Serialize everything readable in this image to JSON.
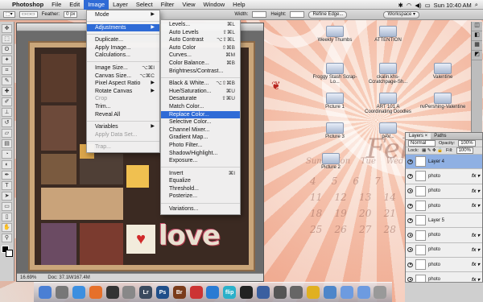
{
  "menubar": {
    "app_name": "Photoshop",
    "items": [
      "File",
      "Edit",
      "Image",
      "Layer",
      "Select",
      "Filter",
      "View",
      "Window",
      "Help"
    ],
    "active": "Image",
    "clock": "Sun 10:40 AM"
  },
  "options": {
    "feather_label": "Feather:",
    "feather_value": "0 px",
    "width_label": "Width:",
    "height_label": "Height:",
    "refine_edge": "Refine Edge...",
    "workspace": "Workspace ▾"
  },
  "document": {
    "title": "",
    "zoom": "16.69%",
    "doc_info": "Doc: 37.1M/167.4M"
  },
  "image_menu": [
    {
      "label": "Mode",
      "submenu": true
    },
    {
      "sep": true
    },
    {
      "label": "Adjustments",
      "submenu": true,
      "selected": true
    },
    {
      "sep": true
    },
    {
      "label": "Duplicate..."
    },
    {
      "label": "Apply Image..."
    },
    {
      "label": "Calculations..."
    },
    {
      "sep": true
    },
    {
      "label": "Image Size...",
      "shortcut": "⌥⌘I"
    },
    {
      "label": "Canvas Size...",
      "shortcut": "⌥⌘C"
    },
    {
      "label": "Pixel Aspect Ratio",
      "submenu": true
    },
    {
      "label": "Rotate Canvas",
      "submenu": true
    },
    {
      "label": "Crop",
      "disabled": true
    },
    {
      "label": "Trim..."
    },
    {
      "label": "Reveal All"
    },
    {
      "sep": true
    },
    {
      "label": "Variables",
      "submenu": true
    },
    {
      "label": "Apply Data Set...",
      "disabled": true
    },
    {
      "sep": true
    },
    {
      "label": "Trap...",
      "disabled": true
    }
  ],
  "adjustments_menu": [
    {
      "label": "Levels...",
      "shortcut": "⌘L"
    },
    {
      "label": "Auto Levels",
      "shortcut": "⇧⌘L"
    },
    {
      "label": "Auto Contrast",
      "shortcut": "⌥⇧⌘L"
    },
    {
      "label": "Auto Color",
      "shortcut": "⇧⌘B"
    },
    {
      "label": "Curves...",
      "shortcut": "⌘M"
    },
    {
      "label": "Color Balance...",
      "shortcut": "⌘B"
    },
    {
      "label": "Brightness/Contrast..."
    },
    {
      "sep": true
    },
    {
      "label": "Black & White...",
      "shortcut": "⌥⇧⌘B"
    },
    {
      "label": "Hue/Saturation...",
      "shortcut": "⌘U"
    },
    {
      "label": "Desaturate",
      "shortcut": "⇧⌘U"
    },
    {
      "label": "Match Color..."
    },
    {
      "label": "Replace Color...",
      "selected": true
    },
    {
      "label": "Selective Color..."
    },
    {
      "label": "Channel Mixer..."
    },
    {
      "label": "Gradient Map..."
    },
    {
      "label": "Photo Filter..."
    },
    {
      "label": "Shadow/Highlight..."
    },
    {
      "label": "Exposure..."
    },
    {
      "sep": true
    },
    {
      "label": "Invert",
      "shortcut": "⌘I"
    },
    {
      "label": "Equalize"
    },
    {
      "label": "Threshold..."
    },
    {
      "label": "Posterize..."
    },
    {
      "sep": true
    },
    {
      "label": "Variations..."
    }
  ],
  "desktop_icons": [
    "Weekly Thumbs",
    "ATTENTION",
    "Froggy Stash Scrap-Lo...",
    "ckalin.khs-Ccratchpage-Sh...",
    "Valentine",
    "Picture 1",
    "Picture 3",
    "ART 101 A Coordinating Doodles",
    "nvPershing-Valentine",
    "Picture 2",
    "pAV..."
  ],
  "layers_panel": {
    "tabs": [
      "Layers ×",
      "Paths"
    ],
    "blend_mode": "Normal",
    "opacity_label": "Opacity:",
    "opacity_value": "100%",
    "lock_label": "Lock:",
    "fill_label": "Fill:",
    "fill_value": "100%",
    "rows": [
      {
        "name": "Layer 4",
        "fx": false,
        "selected": true
      },
      {
        "name": "photo",
        "fx": true
      },
      {
        "name": "photo",
        "fx": true
      },
      {
        "name": "photo",
        "fx": true
      },
      {
        "name": "Layer 5",
        "fx": false
      },
      {
        "name": "photo",
        "fx": true
      },
      {
        "name": "photo",
        "fx": true
      },
      {
        "name": "photo",
        "fx": true
      },
      {
        "name": "photo",
        "fx": true
      }
    ]
  },
  "dock": [
    {
      "name": "finder-icon",
      "label": "",
      "color": "#4a7fd4"
    },
    {
      "name": "system-preferences-icon",
      "label": "",
      "color": "#777"
    },
    {
      "name": "safari-icon",
      "label": "",
      "color": "#3c8fe0"
    },
    {
      "name": "firefox-icon",
      "label": "",
      "color": "#e6702a"
    },
    {
      "name": "dashboard-icon",
      "label": "",
      "color": "#333"
    },
    {
      "name": "photos-icon",
      "label": "",
      "color": "#888"
    },
    {
      "name": "lightroom-icon",
      "label": "Lr",
      "color": "#3a4a5e"
    },
    {
      "name": "photoshop-icon",
      "label": "Ps",
      "color": "#1f4f8a"
    },
    {
      "name": "bridge-icon",
      "label": "Br",
      "color": "#7a3b1a"
    },
    {
      "name": "ical-icon",
      "label": "",
      "color": "#c33"
    },
    {
      "name": "itunes-icon",
      "label": "",
      "color": "#2a7bd3"
    },
    {
      "name": "flip-icon",
      "label": "flip",
      "color": "#2bb0c9"
    },
    {
      "name": "clapboard-icon",
      "label": "",
      "color": "#222"
    },
    {
      "name": "spaces-icon",
      "label": "",
      "color": "#3a5fa0"
    },
    {
      "name": "time-machine-icon",
      "label": "",
      "color": "#555"
    },
    {
      "name": "app-icon",
      "label": "",
      "color": "#666"
    },
    {
      "name": "adium-icon",
      "label": "",
      "color": "#e0b020"
    },
    {
      "name": "network-icon",
      "label": "",
      "color": "#4d86c9"
    },
    {
      "name": "folder-icon",
      "label": "",
      "color": "#6d9be0"
    },
    {
      "name": "downloads-icon",
      "label": "",
      "color": "#6d9be0"
    },
    {
      "name": "trash-icon",
      "label": "",
      "color": "#999"
    }
  ],
  "canvas_text": {
    "love": "love"
  }
}
